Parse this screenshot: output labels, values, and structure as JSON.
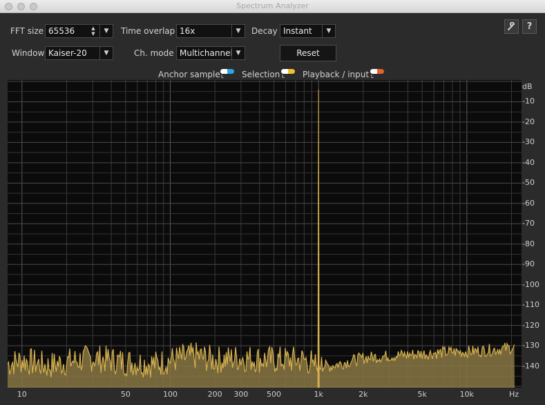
{
  "window": {
    "title": "Spectrum Analyzer"
  },
  "controls": {
    "fft_size_label": "FFT size",
    "fft_size_value": "65536",
    "time_overlap_label": "Time overlap",
    "time_overlap_value": "16x",
    "decay_label": "Decay",
    "decay_value": "Instant",
    "window_label": "Window",
    "window_value": "Kaiser-20",
    "ch_mode_label": "Ch. mode",
    "ch_mode_value": "Multichannel",
    "reset_label": "Reset"
  },
  "icons": {
    "settings": "wrench-icon",
    "help": "?"
  },
  "legend": [
    {
      "label": "Anchor sample",
      "left_color": "#ffffff",
      "right_color": "#2aa8e0",
      "channels": "L R"
    },
    {
      "label": "Selection",
      "left_color": "#ffffff",
      "right_color": "#f0c030",
      "channels": "L R"
    },
    {
      "label": "Playback / input",
      "left_color": "#ffffff",
      "right_color": "#e8602a",
      "channels": "L R"
    }
  ],
  "chart_data": {
    "type": "area",
    "x_scale": "log",
    "y_unit": "dB",
    "x_unit": "Hz",
    "x_ticks": [
      "10",
      "50",
      "100",
      "200",
      "300",
      "500",
      "1k",
      "2k",
      "5k",
      "10k"
    ],
    "y_ticks": [
      "-10",
      "-20",
      "-30",
      "-40",
      "-50",
      "-60",
      "-70",
      "-80",
      "-90",
      "-100",
      "-110",
      "-120",
      "-130",
      "-140"
    ],
    "xlim_hz": [
      8,
      21000
    ],
    "ylim_db": [
      -150,
      0
    ],
    "grid": true,
    "series": [
      {
        "color": "#d7b24d",
        "x": [
          8,
          10,
          15,
          20,
          30,
          50,
          80,
          100,
          150,
          200,
          300,
          500,
          800,
          950,
          1000,
          1050,
          1200,
          2000,
          3000,
          5000,
          8000,
          10000,
          15000,
          20000
        ],
        "y": [
          -140,
          -138,
          -141,
          -139,
          -137,
          -139,
          -140,
          -138,
          -136,
          -138,
          -137,
          -138,
          -138,
          -140,
          -4,
          -140,
          -140,
          -136,
          -135,
          -134,
          -133,
          -133,
          -132,
          -131
        ]
      }
    ]
  }
}
